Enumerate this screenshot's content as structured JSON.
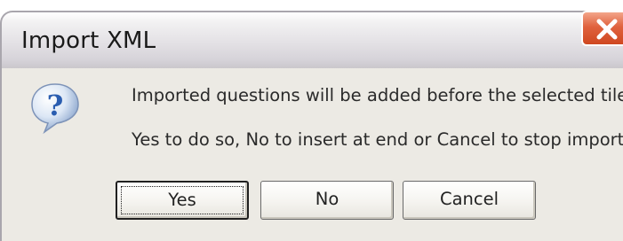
{
  "dialog": {
    "title": "Import XML",
    "icon": "question-icon",
    "message_line1": "Imported questions will be added before the selected tile.",
    "message_line2": "Yes to do so, No to insert at end or Cancel to stop import"
  },
  "buttons": {
    "yes_label": "Yes",
    "no_label": "No",
    "cancel_label": "Cancel"
  },
  "colors": {
    "close_button": "#e0623e",
    "dialog_body": "#eceae4",
    "icon_blue": "#2a5db0"
  }
}
